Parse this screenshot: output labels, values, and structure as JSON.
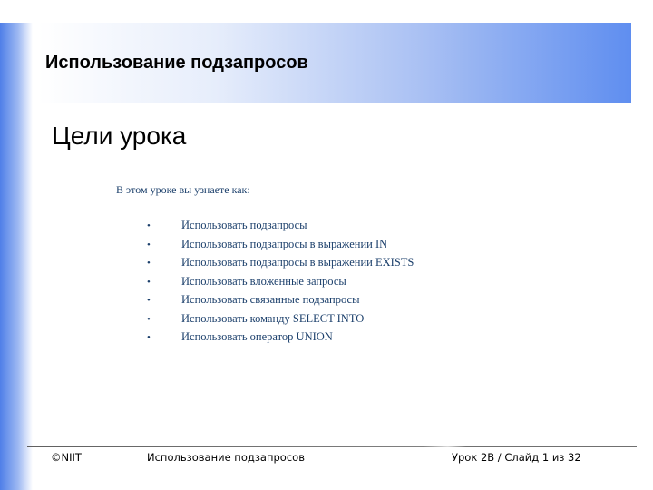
{
  "slide": {
    "title": "Использование подзапросов",
    "heading": "Цели урока",
    "intro": "В этом уроке вы узнаете как:",
    "bullet_symbol": "•",
    "objectives": [
      "Использовать подзапросы",
      "Использовать подзапросы в выражении IN",
      "Использовать подзапросы в выражении EXISTS",
      "Использовать вложенные запросы",
      "Использовать связанные подзапросы",
      "Использовать команду SELECT INTO",
      "Использовать оператор UNION"
    ]
  },
  "footer": {
    "copyright": "©NIIT",
    "topic": "Использование подзапросов",
    "page": "Урок 2В / Слайд 1 из 32"
  },
  "colors": {
    "accent_blue": "#4f7fe8",
    "body_text": "#1b3f6b"
  }
}
